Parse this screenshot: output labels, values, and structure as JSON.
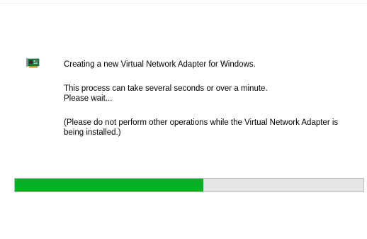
{
  "icons": {
    "adapter": "network-adapter-card-icon"
  },
  "colors": {
    "progress_fill": "#06b025",
    "progress_track": "#e6e6e6",
    "background": "#ffffff"
  },
  "messages": {
    "title": "Creating a new Virtual Network Adapter for Windows.",
    "process": "This process can take several seconds or over a minute.",
    "wait": "Please wait...",
    "note": "(Please do not perform other operations while the Virtual Network Adapter is being installed.)"
  },
  "progress": {
    "fraction": 0.54
  }
}
